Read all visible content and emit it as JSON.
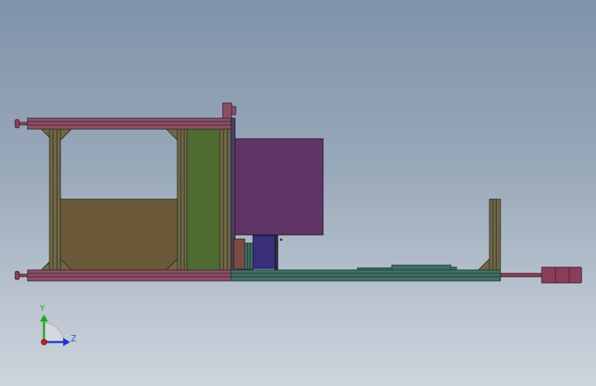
{
  "viewport": {
    "background_top": "#7f93a9",
    "background_bottom": "#cdd4dc"
  },
  "model_colors": {
    "rail": "#8a4f64",
    "frame": "#6e6848",
    "panel_tan": "#6b5838",
    "panel_green": "#4f6b32",
    "box_purple": "#5e3566",
    "base_teal": "#3f7068",
    "motor_blue": "#3a2f7a",
    "handle": "#8a3e5a"
  },
  "triad": {
    "y_label": "Y",
    "z_label": "Z",
    "y_color": "#1faa1f",
    "z_color": "#2434c8",
    "x_color": "#c81e1e"
  }
}
